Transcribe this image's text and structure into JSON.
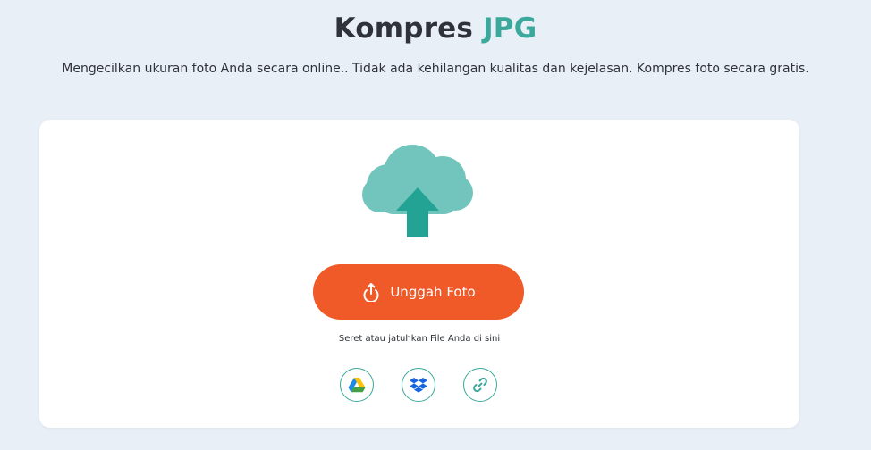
{
  "header": {
    "title_main": "Kompres ",
    "title_accent": "JPG",
    "subtitle": "Mengecilkan ukuran foto Anda secara online.. Tidak ada kehilangan kualitas dan kejelasan. Kompres foto secara gratis."
  },
  "upload": {
    "button_label": "Unggah Foto",
    "drop_hint": "Seret atau jatuhkan File Anda di sini"
  },
  "sources": [
    {
      "name": "google-drive-icon"
    },
    {
      "name": "dropbox-icon"
    },
    {
      "name": "link-icon"
    }
  ],
  "colors": {
    "background": "#e9eff7",
    "accent": "#3aa89a",
    "button": "#ef5a28",
    "cloud": "#72c5bd",
    "arrow": "#22a393"
  }
}
